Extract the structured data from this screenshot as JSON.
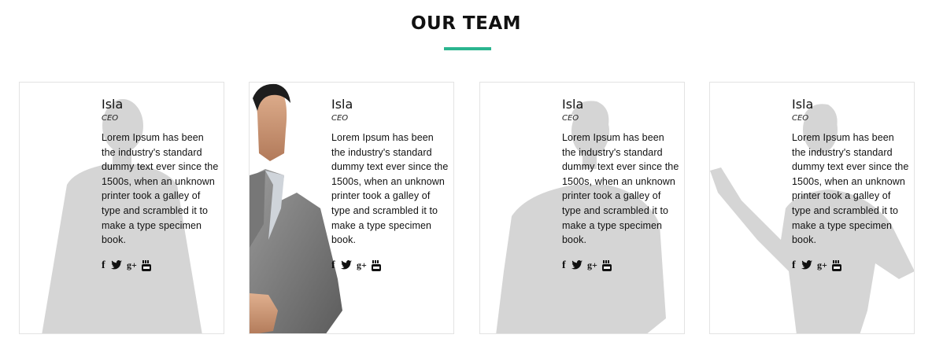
{
  "section": {
    "title": "OUR TEAM",
    "accent_color": "#2bb58f"
  },
  "members": [
    {
      "name": "Isla",
      "role": "CEO",
      "bio": "Lorem Ipsum has been the industry's standard dummy text ever since the 1500s, when an unknown printer took a galley of type and scrambled it to make a type specimen book.",
      "socials": [
        "facebook-icon",
        "twitter-icon",
        "google-plus-icon",
        "youtube-icon"
      ]
    },
    {
      "name": "Isla",
      "role": "CEO",
      "bio": "Lorem Ipsum has been the industry's standard dummy text ever since the 1500s, when an unknown printer took a galley of type and scrambled it to make a type specimen book.",
      "socials": [
        "facebook-icon",
        "twitter-icon",
        "google-plus-icon",
        "youtube-icon"
      ]
    },
    {
      "name": "Isla",
      "role": "CEO",
      "bio": "Lorem Ipsum has been the industry's standard dummy text ever since the 1500s, when an unknown printer took a galley of type and scrambled it to make a type specimen book.",
      "socials": [
        "facebook-icon",
        "twitter-icon",
        "google-plus-icon",
        "youtube-icon"
      ]
    },
    {
      "name": "Isla",
      "role": "CEO",
      "bio": "Lorem Ipsum has been the industry's standard dummy text ever since the 1500s, when an unknown printer took a galley of type and scrambled it to make a type specimen book.",
      "socials": [
        "facebook-icon",
        "twitter-icon",
        "google-plus-icon",
        "youtube-icon"
      ]
    }
  ],
  "social_labels": {
    "facebook": "f",
    "google_plus": "g+"
  },
  "state": {
    "hovered_card": 2
  }
}
